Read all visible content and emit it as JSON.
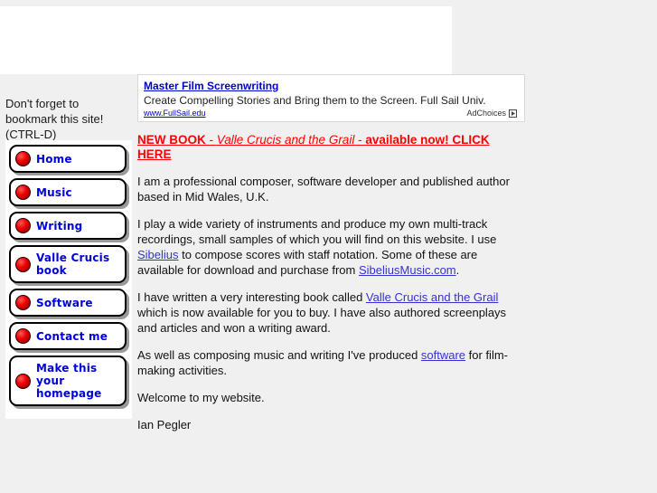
{
  "banner": {
    "name": "top-advertisement-banner",
    "state": "empty"
  },
  "sidebar": {
    "bookmark_note_line1": "Don't forget to",
    "bookmark_note_line2": "bookmark this site!",
    "bookmark_note_line3": "(CTRL-D)",
    "items": [
      {
        "label": "Home",
        "icon": "red-bullet-icon"
      },
      {
        "label": "Music",
        "icon": "red-bullet-icon"
      },
      {
        "label": "Writing",
        "icon": "red-bullet-icon"
      },
      {
        "label": "Valle Crucis book",
        "icon": "red-bullet-icon"
      },
      {
        "label": "Software",
        "icon": "red-bullet-icon"
      },
      {
        "label": "Contact me",
        "icon": "red-bullet-icon"
      },
      {
        "label": "Make this your homepage",
        "icon": "red-bullet-icon"
      }
    ]
  },
  "ad": {
    "title": "Master Film Screenwriting",
    "description": "Create Compelling Stories and Bring them to the Screen. Full Sail Univ.",
    "url": "www.FullSail.edu",
    "adchoices_label": "AdChoices",
    "adchoices_icon": "adchoices-triangle-icon"
  },
  "main": {
    "new_book": {
      "prefix": "NEW BOOK ",
      "dash1": "- ",
      "book_title": "Valle Crucis and the Grail",
      "dash2": " - ",
      "suffix": "available now! CLICK HERE"
    },
    "paragraph1": "I am a professional composer, software developer and published author based in Mid Wales, U.K.",
    "paragraph2": {
      "part1": "I play a wide variety of instruments and produce my own multi-track recordings, small samples of which you will find on this website. I use ",
      "link1": "Sibelius",
      "part2": " to compose scores with staff notation. Some of these are available for download and purchase from ",
      "link2": "SibeliusMusic.com",
      "part3": "."
    },
    "paragraph3": {
      "part1": "I have written a very interesting book called ",
      "link1": "Valle Crucis and the Grail",
      "part2": " which is now available for you to buy. I have also authored screenplays and articles and won a writing award."
    },
    "paragraph4": {
      "part1": "As well as composing music and writing I've produced ",
      "link1": "software",
      "part2": " for film-making activities."
    },
    "paragraph5": "Welcome to my website.",
    "signature": "Ian Pegler"
  },
  "colors": {
    "page_background": "#f0f0f0",
    "panel_white": "#ffffff",
    "nav_label": "#0000dd",
    "link_blue": "#3333cc",
    "alert_red": "#ff0000",
    "bullet_red": "#ee0000",
    "text": "#111111"
  }
}
